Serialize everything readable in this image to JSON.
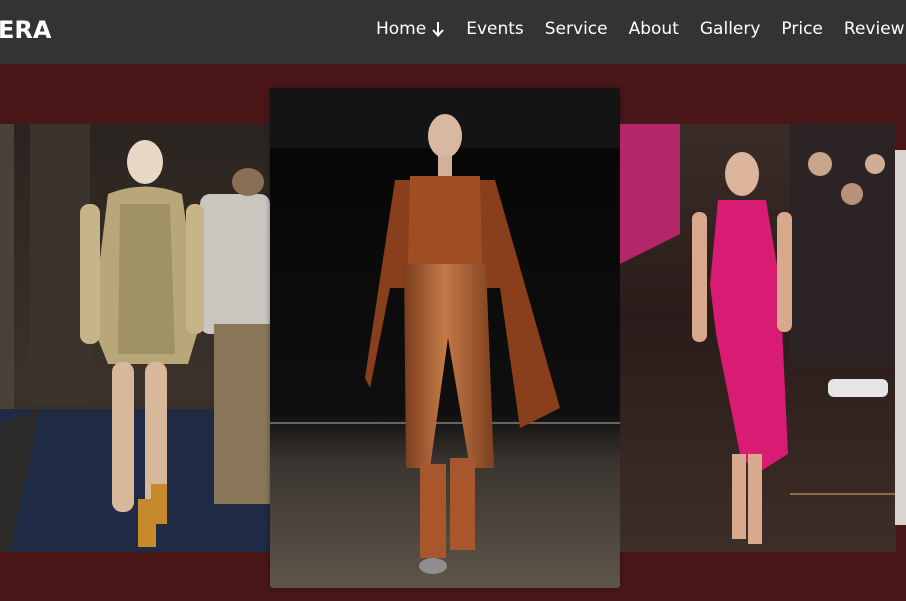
{
  "brand": {
    "text": "ERA"
  },
  "nav": {
    "items": [
      {
        "label": "Home",
        "icon": "arrow-down-icon"
      },
      {
        "label": "Events"
      },
      {
        "label": "Service"
      },
      {
        "label": "About"
      },
      {
        "label": "Gallery"
      },
      {
        "label": "Price"
      },
      {
        "label": "Review"
      }
    ]
  },
  "colors": {
    "navbar": "#333333",
    "background": "#4a1618",
    "nav_text": "#ffffff"
  }
}
